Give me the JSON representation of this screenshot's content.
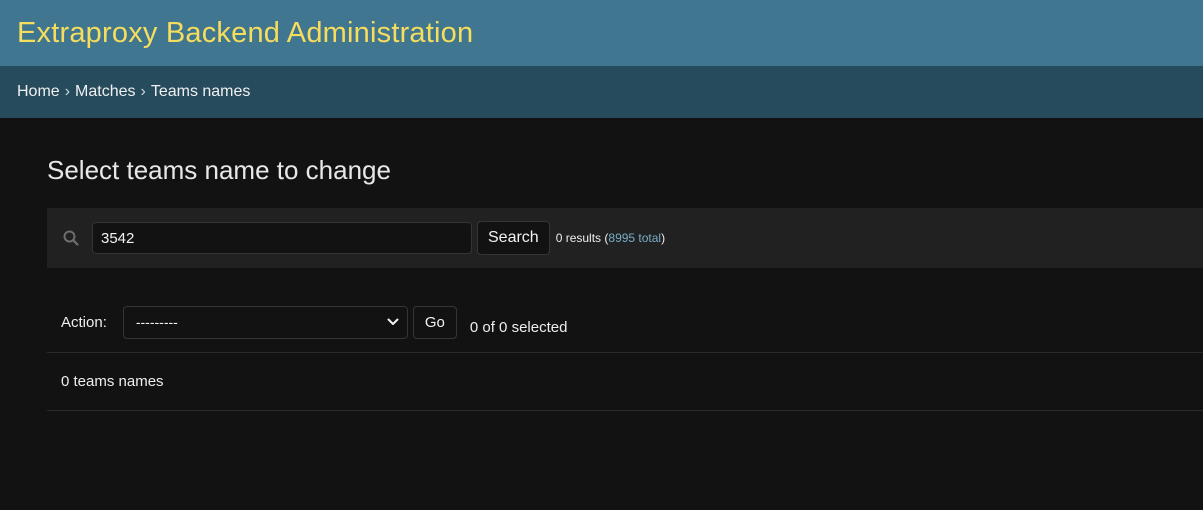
{
  "header": {
    "site_title": "Extraproxy Backend Administration"
  },
  "breadcrumbs": {
    "home": "Home",
    "sep1": "›",
    "matches": "Matches",
    "sep2": "›",
    "current": "Teams names"
  },
  "main": {
    "title": "Select teams name to change"
  },
  "search": {
    "value": "3542",
    "button_label": "Search",
    "results_prefix": "0 results (",
    "total_link": "8995 total",
    "results_suffix": ")"
  },
  "actions": {
    "label": "Action:",
    "selected_option": "---------",
    "go_label": "Go",
    "selected_count": "0 of 0 selected"
  },
  "paginator": {
    "text": "0 teams names"
  },
  "colors": {
    "header_bg": "#417690",
    "breadcrumbs_bg": "#264b5d",
    "title_accent": "#f5dd5d",
    "link": "#79aec8",
    "page_bg": "#121212"
  }
}
